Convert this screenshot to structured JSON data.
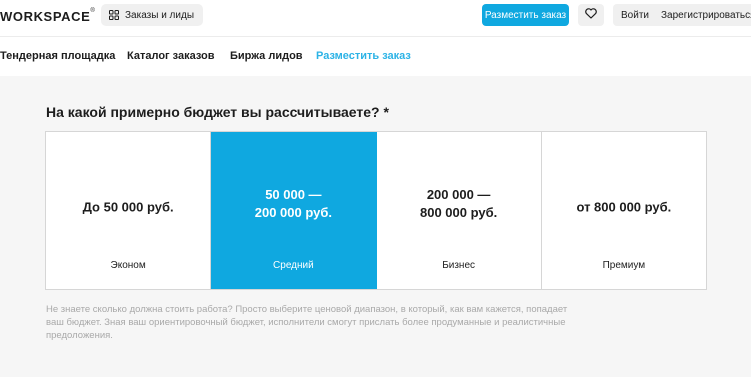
{
  "header": {
    "logo": "WORKSPACE",
    "logo_reg": "®",
    "catalog_chip": "Заказы и лиды",
    "post_order_button": "Разместить заказ",
    "login": "Войти",
    "register": "Зарегистрироваться"
  },
  "nav": {
    "items": [
      {
        "label": "Тендерная площадка"
      },
      {
        "label": "Каталог заказов"
      },
      {
        "label": "Биржа лидов"
      },
      {
        "label": "Разместить заказ"
      }
    ]
  },
  "budget": {
    "question": "На какой примерно бюджет вы рассчитываете? *",
    "options": [
      {
        "price_line1": "До 50 000 руб.",
        "price_line2": "",
        "label": "Эконом"
      },
      {
        "price_line1": "50 000 —",
        "price_line2": "200 000 руб.",
        "label": "Средний"
      },
      {
        "price_line1": "200 000 —",
        "price_line2": "800 000 руб.",
        "label": "Бизнес"
      },
      {
        "price_line1": "от 800 000 руб.",
        "price_line2": "",
        "label": "Премиум"
      }
    ],
    "selected_index": 1,
    "hint": "Не знаете сколько должна стоить работа? Просто выберите ценовой диапазон, в который, как вам кажется, попадает ваш бюджет. Зная ваш ориентировочный бюджет, исполнители смогут прислать более продуманные и реалистичные предоложения."
  },
  "colors": {
    "accent": "#0fa8e0",
    "nav_active": "#2cb3e6",
    "hint_text": "#a9a9a9"
  },
  "icons": {
    "catalog": "grid-icon",
    "favorites": "heart-icon"
  }
}
